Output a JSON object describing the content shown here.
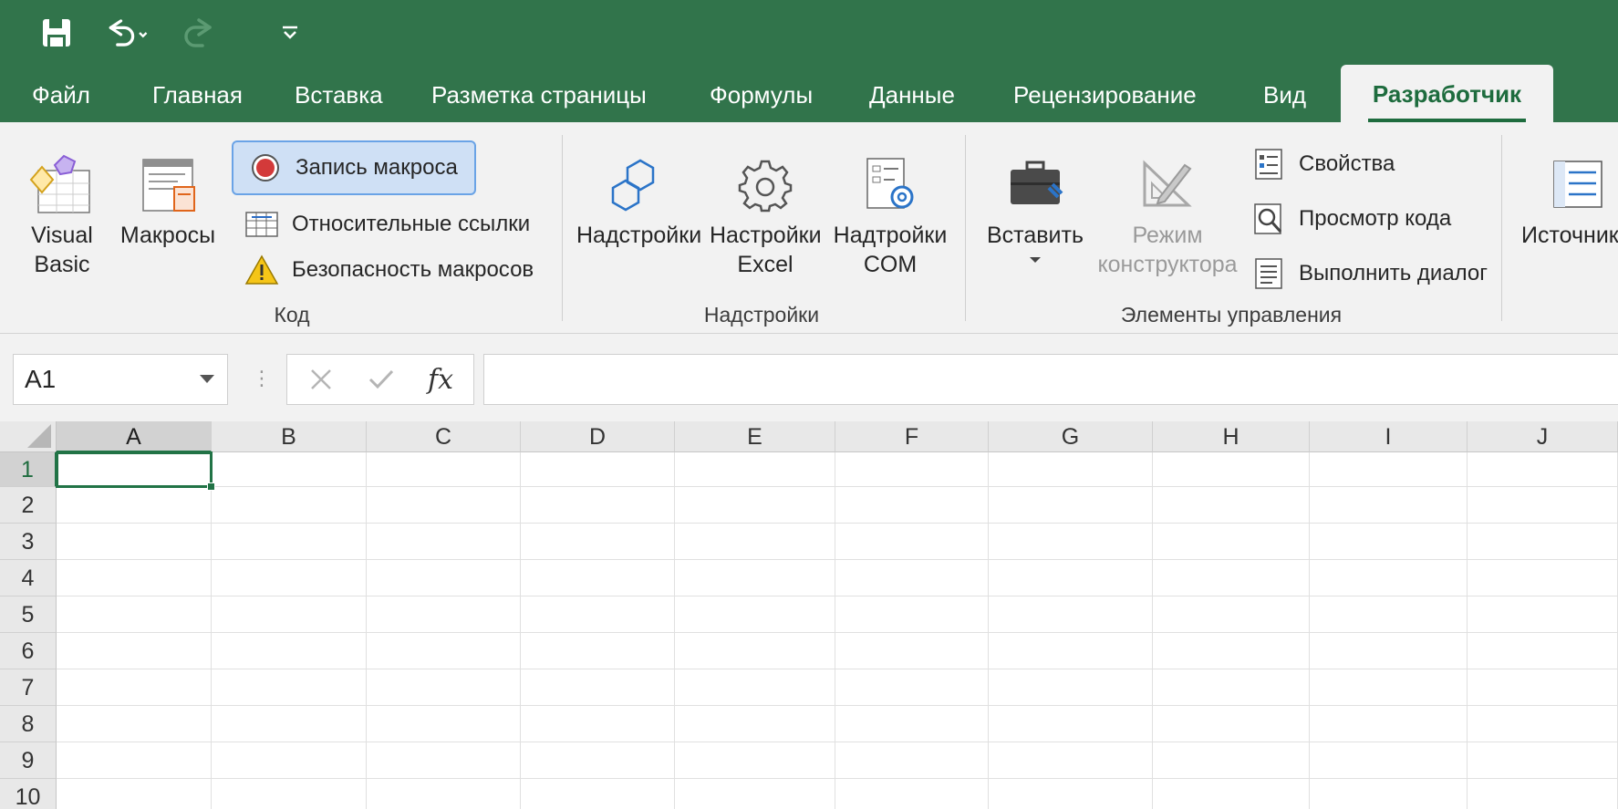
{
  "qat": {
    "save_icon": "save-icon",
    "undo_icon": "undo-icon",
    "redo_icon": "redo-icon",
    "customize_icon": "customize-qat-icon"
  },
  "tabs": [
    {
      "label": "Файл"
    },
    {
      "label": "Главная"
    },
    {
      "label": "Вставка"
    },
    {
      "label": "Разметка страницы"
    },
    {
      "label": "Формулы"
    },
    {
      "label": "Данные"
    },
    {
      "label": "Рецензирование"
    },
    {
      "label": "Вид"
    },
    {
      "label": "Разработчик",
      "active": true
    }
  ],
  "ribbon": {
    "code": {
      "label": "Код",
      "visual_basic": {
        "line1": "Visual",
        "line2": "Basic"
      },
      "macros": "Макросы",
      "record_macro": "Запись макроса",
      "relative_refs": "Относительные ссылки",
      "macro_security": "Безопасность макросов"
    },
    "addins": {
      "label": "Надстройки",
      "addins_btn": "Надстройки",
      "excel_addins": {
        "line1": "Настройки",
        "line2": "Excel"
      },
      "com_addins": {
        "line1": "Надтройки",
        "line2": "COM"
      }
    },
    "controls": {
      "label": "Элементы управления",
      "insert": "Вставить",
      "design_mode": {
        "line1": "Режим",
        "line2": "конструктора"
      },
      "properties": "Свойства",
      "view_code": "Просмотр кода",
      "run_dialog": "Выполнить диалог"
    },
    "xml": {
      "source": "Источник"
    }
  },
  "formula_bar": {
    "name_box": "A1",
    "fx": "fx",
    "value": ""
  },
  "sheet": {
    "columns": [
      "A",
      "B",
      "C",
      "D",
      "E",
      "F",
      "G",
      "H",
      "I",
      "J"
    ],
    "rows": [
      "1",
      "2",
      "3",
      "4",
      "5",
      "6",
      "7",
      "8",
      "9",
      "10"
    ],
    "active_cell": "A1"
  },
  "colors": {
    "brand": "#31744b",
    "active_tab_text": "#1e6c3e",
    "selection": "#217346",
    "record_highlight": "#cfe0f5"
  }
}
